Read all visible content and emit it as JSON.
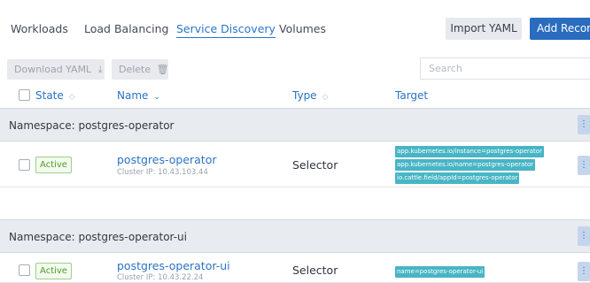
{
  "tabs": [
    {
      "label": "Workloads",
      "active": false
    },
    {
      "label": "Load Balancing",
      "active": false
    },
    {
      "label": "Service Discovery",
      "active": true
    },
    {
      "label": "Volumes",
      "active": false
    }
  ],
  "actions": {
    "import_label": "Import YAML",
    "add_label": "Add Record"
  },
  "toolbar": {
    "download_label": "Download YAML",
    "delete_label": "Delete",
    "search_placeholder": "Search"
  },
  "table": {
    "columns": {
      "state": "State",
      "name": "Name",
      "type": "Type",
      "target": "Target"
    }
  },
  "groups": [
    {
      "namespace_label": "Namespace: postgres-operator",
      "rows": [
        {
          "state": "Active",
          "name": "postgres-operator",
          "cluster_ip": "Cluster IP: 10.43.103.44",
          "type": "Selector",
          "targets": [
            "app.kubernetes.io/instance=postgres-operator",
            "app.kubernetes.io/name=postgres-operator",
            "io.cattle.field/appId=postgres-operator"
          ]
        }
      ]
    },
    {
      "namespace_label": "Namespace: postgres-operator-ui",
      "rows": [
        {
          "state": "Active",
          "name": "postgres-operator-ui",
          "cluster_ip": "Cluster IP: 10.43.22.24",
          "type": "Selector",
          "targets": [
            "name=postgres-operator-ui"
          ]
        }
      ]
    }
  ],
  "colors": {
    "accent": "#2a6cbd",
    "link": "#2a72c4",
    "tag": "#48b5c5",
    "active_badge": "#4f9a2c"
  }
}
